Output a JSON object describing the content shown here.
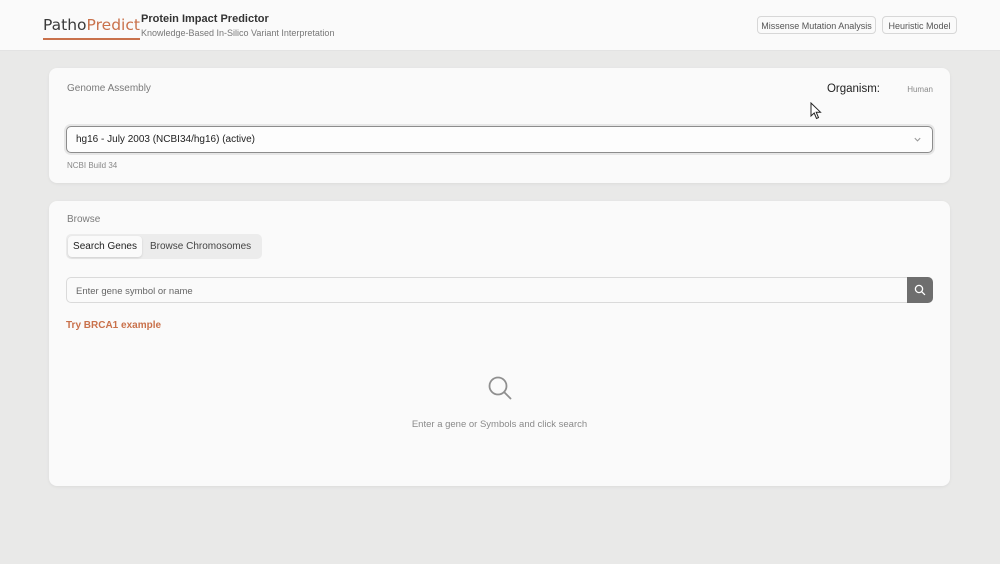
{
  "header": {
    "logo_part1": "Patho",
    "logo_part2": "Predict",
    "title": "Protein Impact Predictor",
    "subtitle": "Knowledge-Based In-Silico Variant Interpretation",
    "nav_buttons": [
      "Missense Mutation Analysis",
      "Heuristic Model"
    ]
  },
  "genome": {
    "section_label": "Genome Assembly",
    "organism_label": "Organism:",
    "organism_value": "Human",
    "selected_assembly": "hg16 - July 2003 (NCBI34/hg16) (active)",
    "build_note": "NCBI Build 34"
  },
  "browse": {
    "section_label": "Browse",
    "tabs": [
      "Search Genes",
      "Browse Chromosomes"
    ],
    "active_tab": "Search Genes",
    "search_placeholder": "Enter gene symbol or name",
    "search_value": "",
    "example_link": "Try BRCA1 example",
    "empty_state_text": "Enter a gene or Symbols and click search"
  },
  "icons": {
    "search_button": "search-icon",
    "empty_state": "search-icon",
    "dropdown": "chevron-down-icon",
    "pointer": "mouse-cursor-icon"
  },
  "colors": {
    "accent": "#c9714b",
    "background": "#e9e9e8",
    "card": "#fafafa",
    "search_button": "#6e6e6e"
  }
}
